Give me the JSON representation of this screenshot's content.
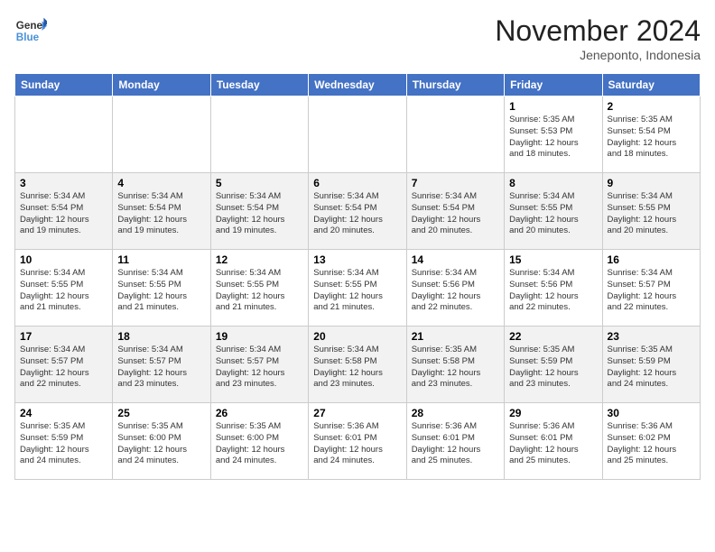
{
  "header": {
    "logo_line1": "General",
    "logo_line2": "Blue",
    "month_title": "November 2024",
    "location": "Jeneponto, Indonesia"
  },
  "weekdays": [
    "Sunday",
    "Monday",
    "Tuesday",
    "Wednesday",
    "Thursday",
    "Friday",
    "Saturday"
  ],
  "weeks": [
    [
      {
        "day": "",
        "info": ""
      },
      {
        "day": "",
        "info": ""
      },
      {
        "day": "",
        "info": ""
      },
      {
        "day": "",
        "info": ""
      },
      {
        "day": "",
        "info": ""
      },
      {
        "day": "1",
        "info": "Sunrise: 5:35 AM\nSunset: 5:53 PM\nDaylight: 12 hours\nand 18 minutes."
      },
      {
        "day": "2",
        "info": "Sunrise: 5:35 AM\nSunset: 5:54 PM\nDaylight: 12 hours\nand 18 minutes."
      }
    ],
    [
      {
        "day": "3",
        "info": "Sunrise: 5:34 AM\nSunset: 5:54 PM\nDaylight: 12 hours\nand 19 minutes."
      },
      {
        "day": "4",
        "info": "Sunrise: 5:34 AM\nSunset: 5:54 PM\nDaylight: 12 hours\nand 19 minutes."
      },
      {
        "day": "5",
        "info": "Sunrise: 5:34 AM\nSunset: 5:54 PM\nDaylight: 12 hours\nand 19 minutes."
      },
      {
        "day": "6",
        "info": "Sunrise: 5:34 AM\nSunset: 5:54 PM\nDaylight: 12 hours\nand 20 minutes."
      },
      {
        "day": "7",
        "info": "Sunrise: 5:34 AM\nSunset: 5:54 PM\nDaylight: 12 hours\nand 20 minutes."
      },
      {
        "day": "8",
        "info": "Sunrise: 5:34 AM\nSunset: 5:55 PM\nDaylight: 12 hours\nand 20 minutes."
      },
      {
        "day": "9",
        "info": "Sunrise: 5:34 AM\nSunset: 5:55 PM\nDaylight: 12 hours\nand 20 minutes."
      }
    ],
    [
      {
        "day": "10",
        "info": "Sunrise: 5:34 AM\nSunset: 5:55 PM\nDaylight: 12 hours\nand 21 minutes."
      },
      {
        "day": "11",
        "info": "Sunrise: 5:34 AM\nSunset: 5:55 PM\nDaylight: 12 hours\nand 21 minutes."
      },
      {
        "day": "12",
        "info": "Sunrise: 5:34 AM\nSunset: 5:55 PM\nDaylight: 12 hours\nand 21 minutes."
      },
      {
        "day": "13",
        "info": "Sunrise: 5:34 AM\nSunset: 5:55 PM\nDaylight: 12 hours\nand 21 minutes."
      },
      {
        "day": "14",
        "info": "Sunrise: 5:34 AM\nSunset: 5:56 PM\nDaylight: 12 hours\nand 22 minutes."
      },
      {
        "day": "15",
        "info": "Sunrise: 5:34 AM\nSunset: 5:56 PM\nDaylight: 12 hours\nand 22 minutes."
      },
      {
        "day": "16",
        "info": "Sunrise: 5:34 AM\nSunset: 5:57 PM\nDaylight: 12 hours\nand 22 minutes."
      }
    ],
    [
      {
        "day": "17",
        "info": "Sunrise: 5:34 AM\nSunset: 5:57 PM\nDaylight: 12 hours\nand 22 minutes."
      },
      {
        "day": "18",
        "info": "Sunrise: 5:34 AM\nSunset: 5:57 PM\nDaylight: 12 hours\nand 23 minutes."
      },
      {
        "day": "19",
        "info": "Sunrise: 5:34 AM\nSunset: 5:57 PM\nDaylight: 12 hours\nand 23 minutes."
      },
      {
        "day": "20",
        "info": "Sunrise: 5:34 AM\nSunset: 5:58 PM\nDaylight: 12 hours\nand 23 minutes."
      },
      {
        "day": "21",
        "info": "Sunrise: 5:35 AM\nSunset: 5:58 PM\nDaylight: 12 hours\nand 23 minutes."
      },
      {
        "day": "22",
        "info": "Sunrise: 5:35 AM\nSunset: 5:59 PM\nDaylight: 12 hours\nand 23 minutes."
      },
      {
        "day": "23",
        "info": "Sunrise: 5:35 AM\nSunset: 5:59 PM\nDaylight: 12 hours\nand 24 minutes."
      }
    ],
    [
      {
        "day": "24",
        "info": "Sunrise: 5:35 AM\nSunset: 5:59 PM\nDaylight: 12 hours\nand 24 minutes."
      },
      {
        "day": "25",
        "info": "Sunrise: 5:35 AM\nSunset: 6:00 PM\nDaylight: 12 hours\nand 24 minutes."
      },
      {
        "day": "26",
        "info": "Sunrise: 5:35 AM\nSunset: 6:00 PM\nDaylight: 12 hours\nand 24 minutes."
      },
      {
        "day": "27",
        "info": "Sunrise: 5:36 AM\nSunset: 6:01 PM\nDaylight: 12 hours\nand 24 minutes."
      },
      {
        "day": "28",
        "info": "Sunrise: 5:36 AM\nSunset: 6:01 PM\nDaylight: 12 hours\nand 25 minutes."
      },
      {
        "day": "29",
        "info": "Sunrise: 5:36 AM\nSunset: 6:01 PM\nDaylight: 12 hours\nand 25 minutes."
      },
      {
        "day": "30",
        "info": "Sunrise: 5:36 AM\nSunset: 6:02 PM\nDaylight: 12 hours\nand 25 minutes."
      }
    ]
  ]
}
